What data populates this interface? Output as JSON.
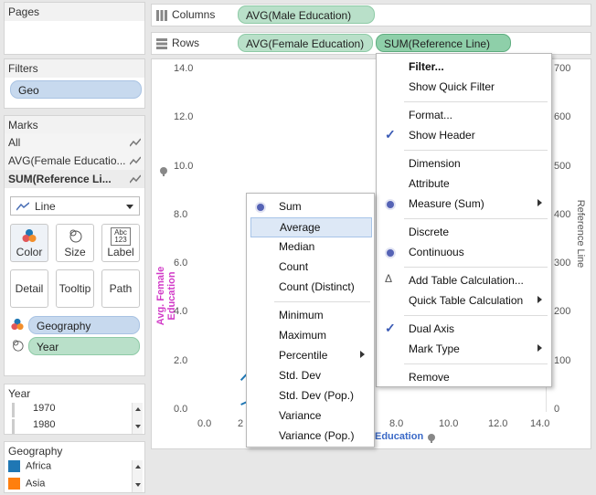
{
  "pages": {
    "title": "Pages"
  },
  "filters": {
    "title": "Filters",
    "pills": [
      "Geo"
    ]
  },
  "marks": {
    "title": "Marks",
    "rows": [
      "All",
      "AVG(Female Educatio...",
      "SUM(Reference Li..."
    ],
    "mark_type": "Line",
    "buttons": {
      "color": "Color",
      "size": "Size",
      "label": "Label",
      "detail": "Detail",
      "tooltip": "Tooltip",
      "path": "Path"
    },
    "label_icon_text": "Abc\n123",
    "fields": [
      {
        "name": "Geography",
        "color": "#c7d9ee"
      },
      {
        "name": "Year",
        "color": "#b9e0c9"
      }
    ]
  },
  "year_legend": {
    "title": "Year",
    "items": [
      "1970",
      "1980"
    ]
  },
  "geo_legend": {
    "title": "Geography",
    "items": [
      {
        "name": "Africa",
        "color": "#1f77b4"
      },
      {
        "name": "Asia",
        "color": "#ff7f0e"
      }
    ]
  },
  "columns_shelf": {
    "label": "Columns",
    "pills": [
      "AVG(Male Education)"
    ]
  },
  "rows_shelf": {
    "label": "Rows",
    "pills": [
      "AVG(Female Education)",
      "SUM(Reference Line)"
    ]
  },
  "chart_data": {
    "type": "line",
    "ylabel": "Avg. Female Education",
    "y2label": "Reference Line",
    "xlabel_visible": "Education",
    "y_ticks": [
      "14.0",
      "12.0",
      "10.0",
      "8.0",
      "6.0",
      "4.0",
      "2.0",
      "0.0"
    ],
    "x_ticks": [
      "0.0",
      "2",
      "8.0",
      "10.0",
      "12.0",
      "14.0"
    ],
    "y2_ticks": [
      "700",
      "600",
      "500",
      "400",
      "300",
      "200",
      "100",
      "0"
    ],
    "ylim": [
      0,
      14
    ],
    "xlim": [
      0,
      14
    ],
    "series": [
      {
        "values_x": [
          1.5,
          2.2
        ],
        "values_y": [
          1.3,
          2.0
        ],
        "color": "#1f77b4"
      },
      {
        "values_x": [
          1.5,
          2.2
        ],
        "values_y": [
          0.3,
          0.6
        ],
        "color": "#1f77b4"
      }
    ]
  },
  "context_menu": {
    "items": [
      {
        "label": "Filter...",
        "bold": true
      },
      {
        "label": "Show Quick Filter"
      },
      {
        "sep": true
      },
      {
        "label": "Format..."
      },
      {
        "label": "Show Header",
        "check": true
      },
      {
        "sep": true
      },
      {
        "label": "Dimension"
      },
      {
        "label": "Attribute"
      },
      {
        "label": "Measure (Sum)",
        "radio": true,
        "submenu": true
      },
      {
        "sep": true
      },
      {
        "label": "Discrete"
      },
      {
        "label": "Continuous",
        "radio": true
      },
      {
        "sep": true
      },
      {
        "label": "Add Table Calculation...",
        "delta": true
      },
      {
        "label": "Quick Table Calculation",
        "submenu": true
      },
      {
        "sep": true
      },
      {
        "label": "Dual Axis",
        "check": true
      },
      {
        "label": "Mark Type",
        "submenu": true
      },
      {
        "sep": true
      },
      {
        "label": "Remove"
      }
    ]
  },
  "measure_submenu": {
    "items": [
      {
        "label": "Sum",
        "radio": true
      },
      {
        "label": "Average",
        "highlight": true
      },
      {
        "label": "Median"
      },
      {
        "label": "Count"
      },
      {
        "label": "Count (Distinct)"
      },
      {
        "sep": true
      },
      {
        "label": "Minimum"
      },
      {
        "label": "Maximum"
      },
      {
        "label": "Percentile",
        "submenu": true
      },
      {
        "label": "Std. Dev"
      },
      {
        "label": "Std. Dev (Pop.)"
      },
      {
        "label": "Variance"
      },
      {
        "label": "Variance (Pop.)"
      }
    ]
  },
  "colors": {
    "accent_radio": "#5563b5",
    "highlight": "#dde8f6",
    "ylabel": "#d23cc8",
    "xlabel": "#3a69c7"
  }
}
